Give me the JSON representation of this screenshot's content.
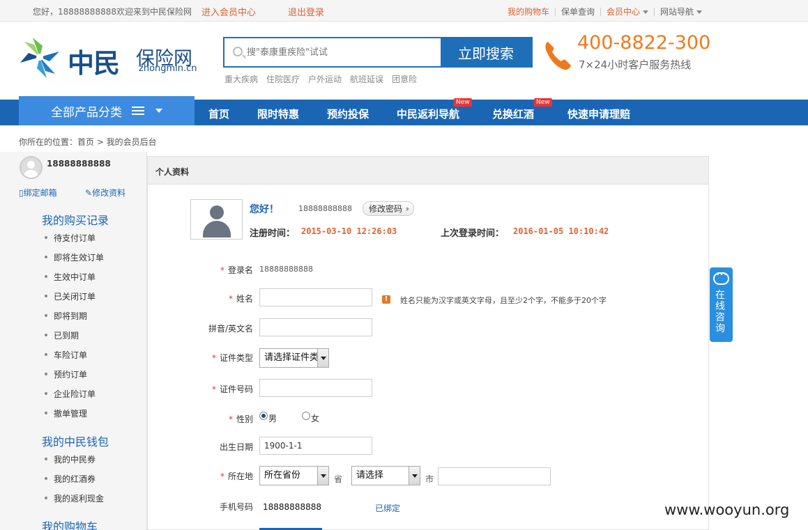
{
  "topbar": {
    "greeting": "您好，18888888888欢迎来到中民保险网",
    "enter_member": "进入会员中心",
    "logout": "退出登录",
    "cart": "我的购物车",
    "policy_query": "保单查询",
    "member_center": "会员中心",
    "site_nav": "网站导航"
  },
  "logo": {
    "name": "中民",
    "name2": "保险网",
    "domain": "zhongmin.cn",
    "mark_icon": "pinwheel-logo-icon"
  },
  "search": {
    "placeholder": "搜\"泰康重疾险\"试试",
    "button": "立即搜索",
    "hot": [
      "重大疾病",
      "住院医疗",
      "户外运动",
      "航班延误",
      "团意险"
    ]
  },
  "hotline": {
    "number": "400-8822-300",
    "subtitle": "7×24小时客户服务热线"
  },
  "nav": {
    "all_products": "全部产品分类",
    "items": [
      "首页",
      "限时特惠",
      "预约投保",
      "中民返利导航",
      "兑换红酒",
      "快速申请理赔"
    ],
    "new_badge": "New"
  },
  "breadcrumb": "你所在的位置：首页 > 我的会员后台",
  "sidebar": {
    "username": "18888888888",
    "bind_email": "绑定邮箱",
    "edit_profile": "修改资料",
    "section1": "我的购买记录",
    "section1_items": [
      "待支付订单",
      "即将生效订单",
      "生效中订单",
      "已关闭订单",
      "即将到期",
      "已到期",
      "车险订单",
      "预约订单",
      "企业险订单",
      "撤单管理"
    ],
    "section2": "我的中民钱包",
    "section2_items": [
      "我的中民券",
      "我的红酒券",
      "我的返利现金"
    ],
    "section3": "我的购物车"
  },
  "panel": {
    "title": "个人资料",
    "hello": "您好！",
    "username": "18888888888",
    "change_pwd": "修改密码",
    "reg_label": "注册时间：",
    "reg_time": "2015-03-10 12:26:03",
    "last_label": "上次登录时间：",
    "last_time": "2016-01-05 10:10:42"
  },
  "form": {
    "login_label": "登录名",
    "login_value": "18888888888",
    "name_label": "姓名",
    "name_hint": "姓名只能为汉字或英文字母，且至少2个字，不能多于20个字",
    "pinyin_label": "拼音/英文名",
    "idtype_label": "证件类型",
    "idtype_value": "请选择证件类",
    "idno_label": "证件号码",
    "gender_label": "性别",
    "male": "男",
    "female": "女",
    "birth_label": "出生日期",
    "birth_value": "1900-1-1",
    "location_label": "所在地",
    "province_value": "所在省份",
    "province_unit": "省",
    "city_value": "请选择",
    "city_unit": "市",
    "phone_label": "手机号码",
    "phone_value": "18888888888",
    "phone_status": "已绑定"
  },
  "float": {
    "consult": "在线咨询"
  },
  "watermark": "www.wooyun.org",
  "colors": {
    "brand_blue": "#1a66b5",
    "accent_orange": "#e2612f",
    "nav_highlight": "#3d8be0"
  }
}
